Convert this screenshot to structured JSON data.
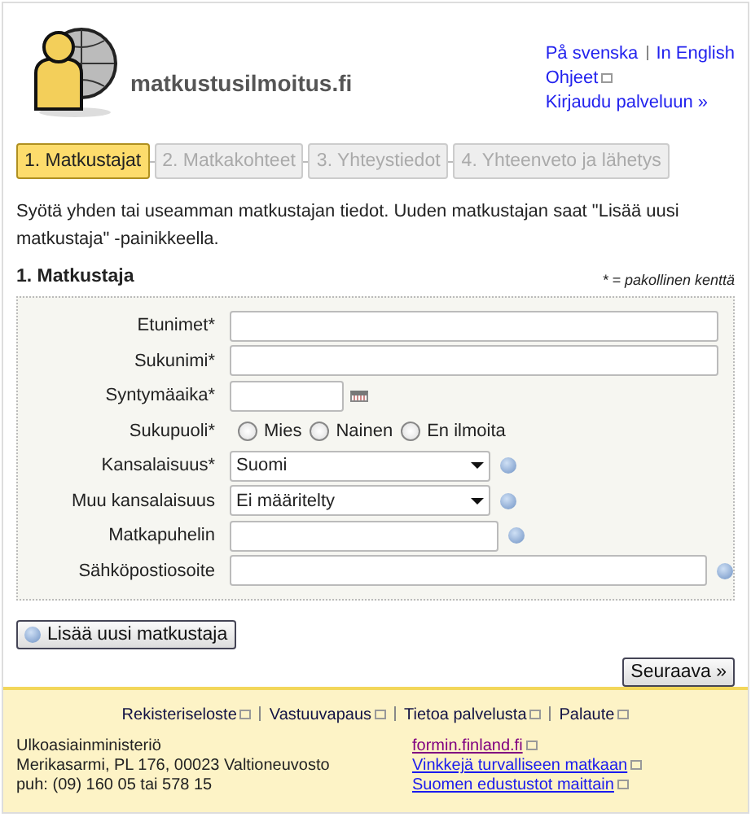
{
  "header": {
    "site_title": "matkustusilmoitus.fi",
    "language_links": [
      "På svenska",
      "In English"
    ],
    "help_link": "Ohjeet",
    "login_link": "Kirjaudu palveluun »"
  },
  "steps": [
    {
      "label": "1. Matkustajat",
      "selected": true
    },
    {
      "label": "2. Matkakohteet",
      "selected": false
    },
    {
      "label": "3. Yhteystiedot",
      "selected": false
    },
    {
      "label": "4. Yhteenveto ja lähetys",
      "selected": false
    }
  ],
  "intro": "Syötä yhden tai useamman matkustajan tiedot. Uuden matkustajan saat \"Lisää uusi matkustaja\" -painikkeella.",
  "section": {
    "title": "1. Matkustaja",
    "required_note": "* = pakollinen kenttä"
  },
  "fields": [
    {
      "kind": "text",
      "label": "Etunimet*",
      "help": false
    },
    {
      "kind": "text",
      "label": "Sukunimi*",
      "help": false
    },
    {
      "kind": "date",
      "label": "Syntymäaika*",
      "help": false
    },
    {
      "kind": "radio",
      "label": "Sukupuoli*",
      "options": [
        {
          "label": "Mies",
          "checked": false
        },
        {
          "label": "Nainen",
          "checked": false
        },
        {
          "label": "En ilmoita",
          "checked": false
        }
      ],
      "help": false
    },
    {
      "kind": "select",
      "label": "Kansalaisuus*",
      "value": "Suomi",
      "help": true
    },
    {
      "kind": "select",
      "label": "Muu kansalaisuus",
      "value": "Ei määritelty",
      "help": true
    },
    {
      "kind": "phone",
      "label": "Matkapuhelin",
      "help": true
    },
    {
      "kind": "email",
      "label": "Sähköpostiosoite",
      "help": true
    }
  ],
  "add_button": "Lisää uusi matkustaja",
  "next_button": "Seuraava »",
  "footer": {
    "links": [
      "Rekisteriseloste",
      "Vastuuvapaus",
      "Tietoa palvelusta",
      "Palaute"
    ],
    "address_lines": [
      "Ulkoasiainministeriö",
      "Merikasarmi, PL 176, 00023 Valtioneuvosto",
      "puh: (09) 160 05 tai 578 15"
    ],
    "external_links": [
      {
        "label": "formin.finland.fi",
        "visited": true
      },
      {
        "label": "Vinkkejä turvalliseen matkaan",
        "visited": false
      },
      {
        "label": "Suomen edustustot maittain",
        "visited": false
      }
    ]
  }
}
